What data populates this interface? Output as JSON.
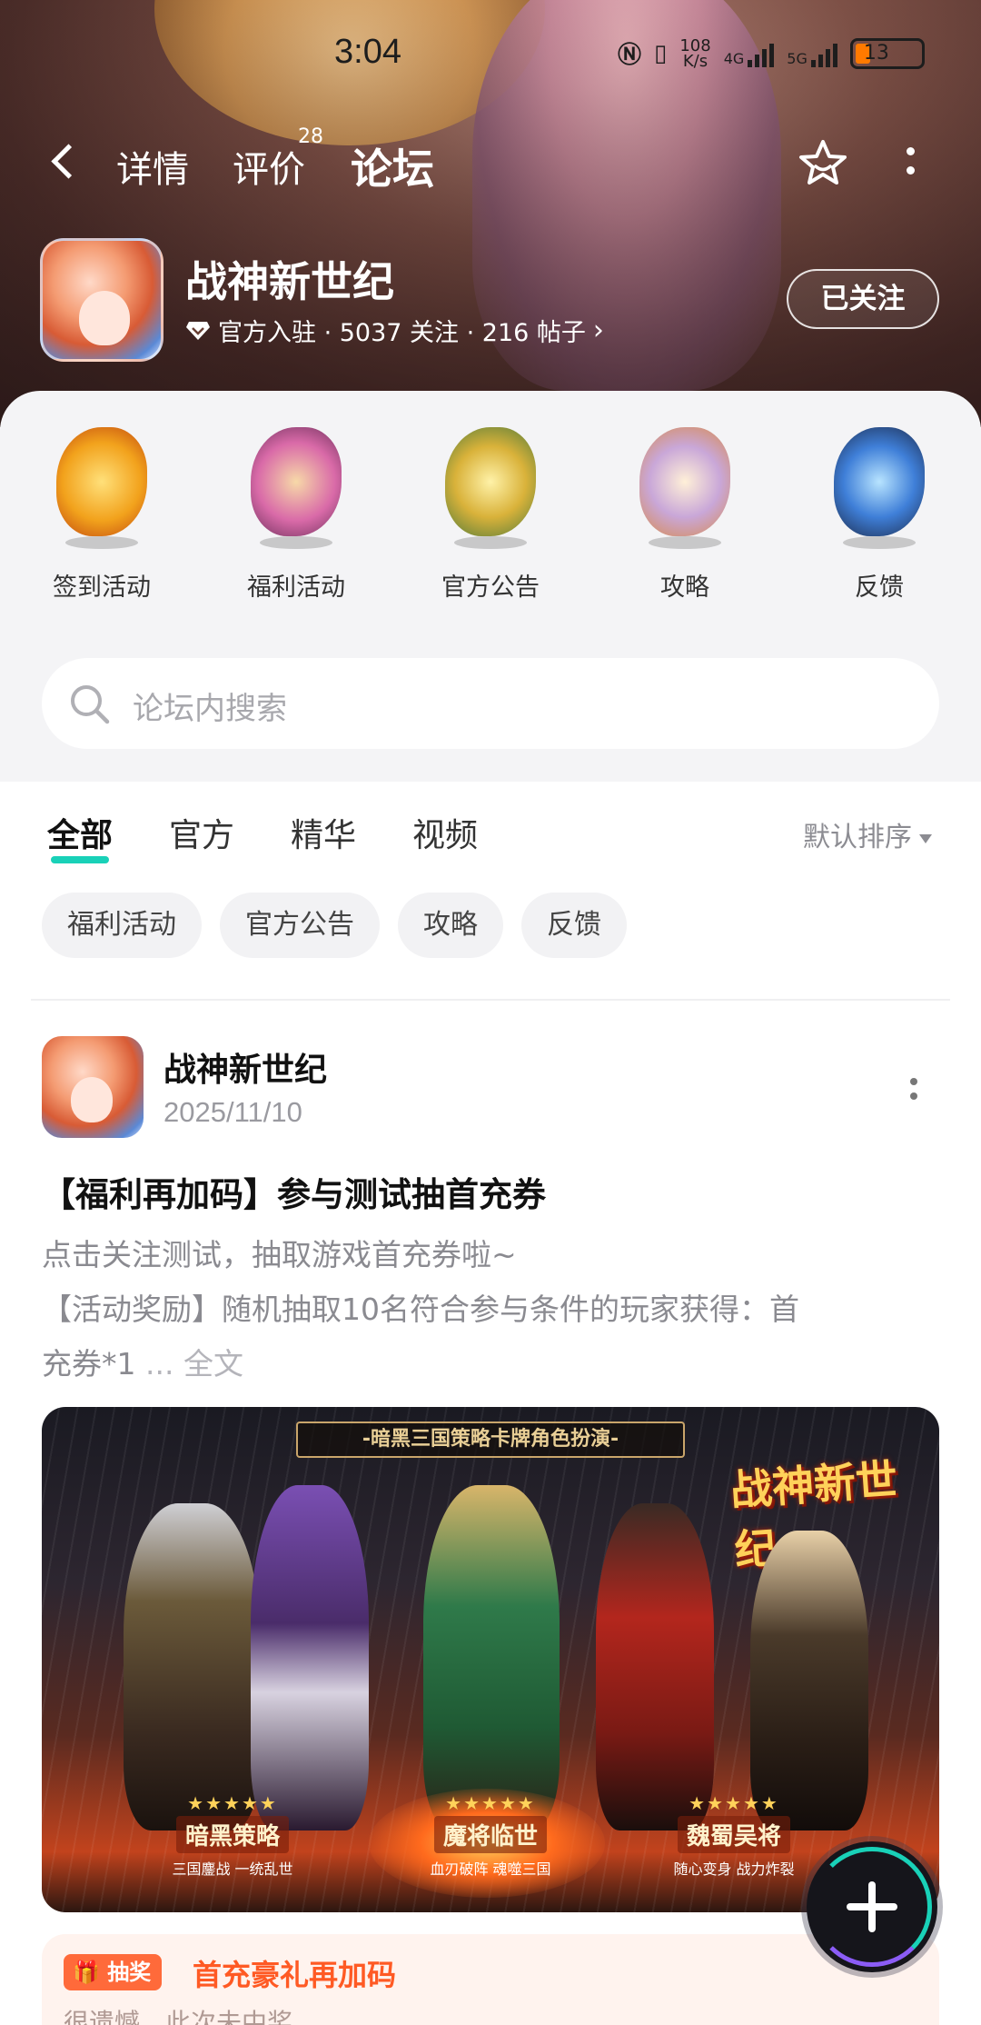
{
  "status_bar": {
    "time": "3:04",
    "net_speed_top": "108",
    "net_speed_unit": "K/s",
    "net_4g": "4G",
    "net_5g": "5G",
    "battery": "13"
  },
  "nav": {
    "tabs": [
      {
        "label": "详情"
      },
      {
        "label": "评价",
        "badge": "28"
      },
      {
        "label": "论坛"
      }
    ],
    "active_tab": "论坛"
  },
  "game": {
    "title": "战神新世纪",
    "meta": "官方入驻 · 5037 关注 · 216 帖子",
    "follow_label": "已关注"
  },
  "quick_entries": [
    {
      "label": "签到活动",
      "icon": "phoenix-warrior-icon",
      "color": "#f2a21c"
    },
    {
      "label": "福利活动",
      "icon": "dancer-warrior-icon",
      "color": "#d96aa8"
    },
    {
      "label": "官方公告",
      "icon": "golden-dragon-warrior-icon",
      "color": "#d9b23a"
    },
    {
      "label": "攻略",
      "icon": "dragon-mage-icon",
      "color": "#c9a7d8"
    },
    {
      "label": "反馈",
      "icon": "blue-dragon-knight-icon",
      "color": "#3f7fd8"
    }
  ],
  "search": {
    "placeholder": "论坛内搜索"
  },
  "filter_tabs": [
    {
      "label": "全部"
    },
    {
      "label": "官方"
    },
    {
      "label": "精华"
    },
    {
      "label": "视频"
    }
  ],
  "active_filter": "全部",
  "sort_label": "默认排序",
  "chips": [
    "福利活动",
    "官方公告",
    "攻略",
    "反馈"
  ],
  "post": {
    "author": "战神新世纪",
    "date": "2025/11/10",
    "title": "【福利再加码】参与测试抽首充券",
    "line1": "点击关注测试，抽取游戏首充券啦~",
    "line2": "【活动奖励】随机抽取10名符合参与条件的玩家获得：首",
    "line3": "充券*1",
    "line3_more": " ... 全文",
    "image": {
      "banner": "-暗黑三国策略卡牌角色扮演-",
      "logo": "战神新世纪",
      "awards": [
        {
          "stars": "★★★★★",
          "name": "暗黑策略",
          "sub": "三国鏖战 一统乱世"
        },
        {
          "stars": "★★★★★",
          "name": "魔将临世",
          "sub": "血刃破阵 魂噬三国"
        },
        {
          "stars": "★★★★★",
          "name": "魏蜀吴将",
          "sub": "随心变身 战力炸裂"
        }
      ]
    }
  },
  "prize": {
    "tag": "抽奖",
    "title": "首充豪礼再加码",
    "sub": "很遗憾，此次未中奖"
  },
  "colors": {
    "accent": "#19d1b8",
    "prize_orange": "#ff5a24"
  }
}
